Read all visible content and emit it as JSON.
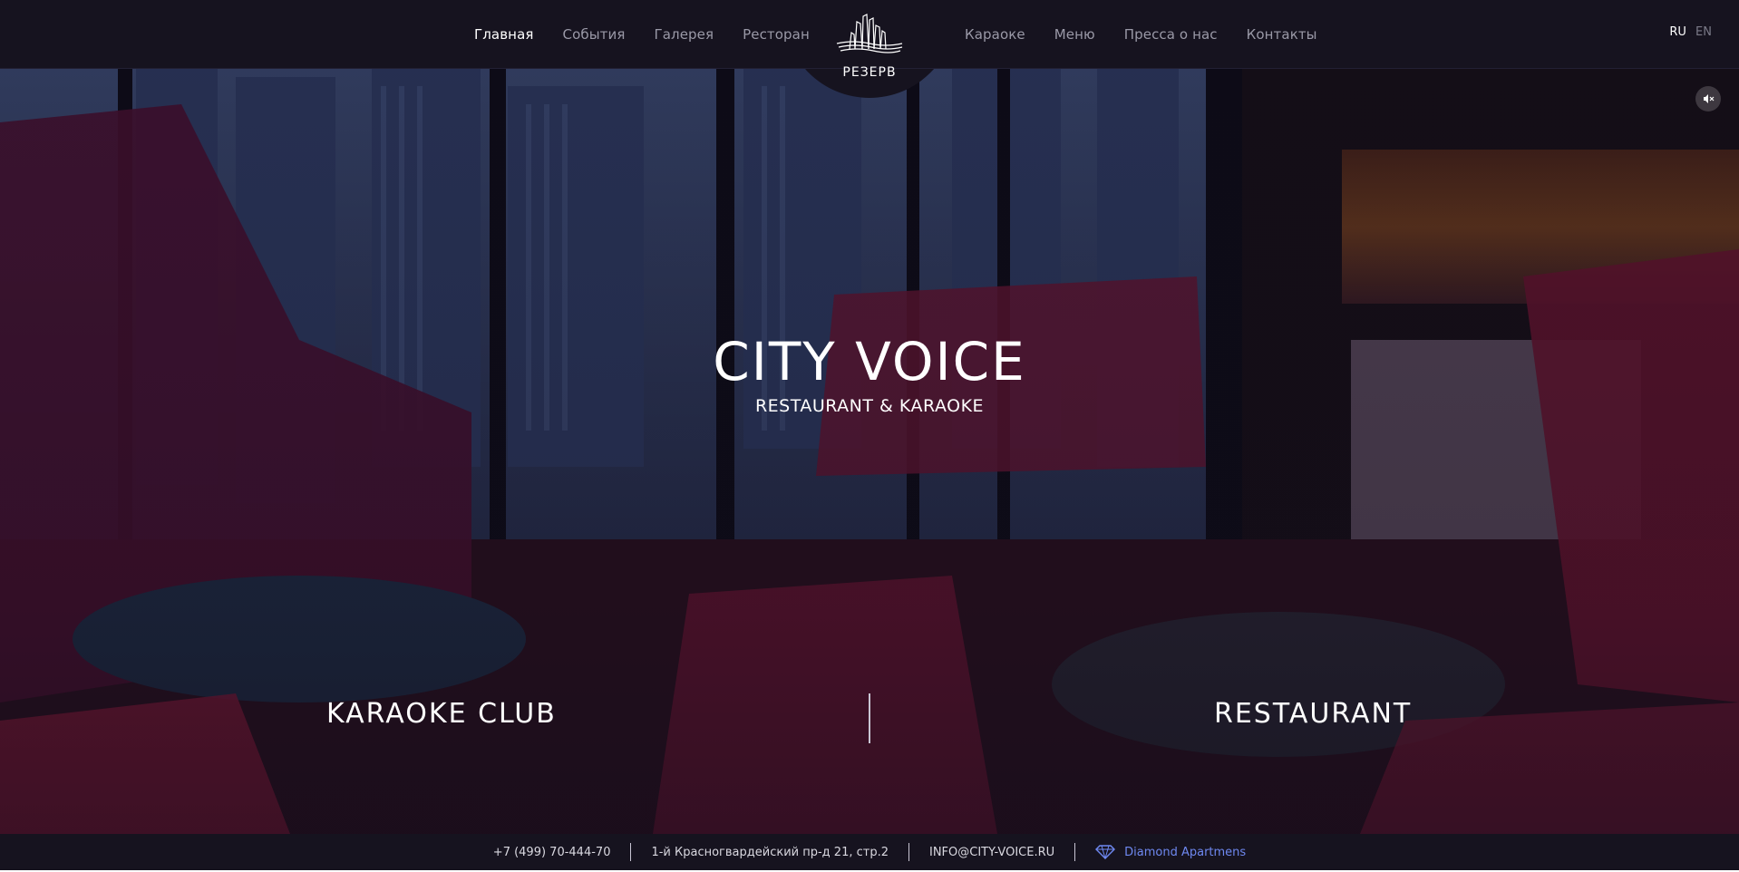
{
  "header": {
    "nav_left": [
      "Главная",
      "События",
      "Галерея",
      "Ресторан"
    ],
    "nav_right": [
      "Караоке",
      "Меню",
      "Пресса о нас",
      "Контакты"
    ],
    "active_item": "Главная",
    "reserve_label": "РЕЗЕРВ",
    "languages": {
      "current": "RU",
      "other": "EN"
    },
    "logo_icon": "city-skyline-logo"
  },
  "hero": {
    "title": "CITY VOICE",
    "subtitle": "RESTAURANT & KARAOKE",
    "left_section": "KARAOKE CLUB",
    "right_section": "RESTAURANT",
    "mute_icon": "speaker-muted-icon"
  },
  "footer": {
    "phone": "+7 (499) 70-444-70",
    "address": "1-й Красногвардейский пр-д 21, стр.2",
    "email": "INFO@CITY-VOICE.RU",
    "partner": "Diamond Apartmens",
    "partner_icon": "diamond-icon"
  },
  "colors": {
    "header_bg": "#16131f",
    "accent_link": "#6e88f0",
    "text_primary": "#ffffff",
    "text_muted": "#9a99a7"
  }
}
